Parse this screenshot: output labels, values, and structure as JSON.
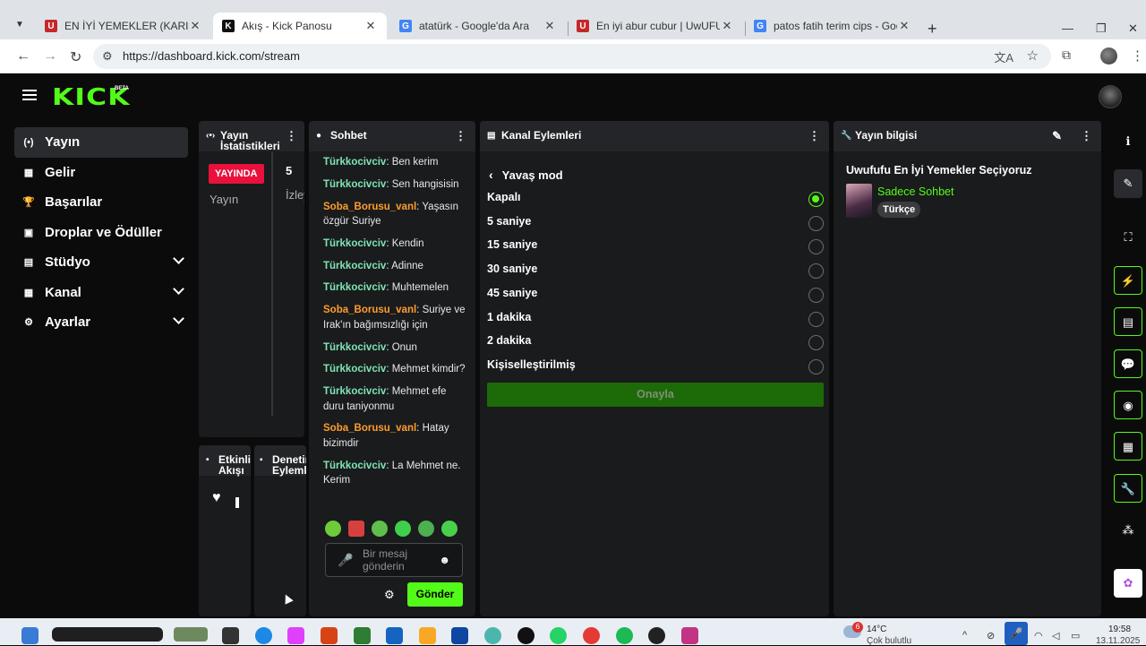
{
  "browser": {
    "tabs": [
      {
        "title": "EN İYİ YEMEKLER (KARIŞIK) @m",
        "fav_text": "U",
        "fav_color": "#c62828"
      },
      {
        "title": "Akış - Kick Panosu",
        "fav_text": "K",
        "fav_color": "#111111"
      },
      {
        "title": "atatürk - Google'da Ara",
        "fav_text": "G",
        "fav_color": "#4285f4"
      },
      {
        "title": "En iyi abur cubur | UwUFUFU",
        "fav_text": "U",
        "fav_color": "#c62828"
      },
      {
        "title": "patos fatih terim cips - Google",
        "fav_text": "G",
        "fav_color": "#4285f4"
      }
    ],
    "url": "https://dashboard.kick.com/stream"
  },
  "app": {
    "logo": "KICK",
    "logo_badge": "BETA",
    "accent": "#53fc18"
  },
  "sidebar": {
    "items": [
      {
        "label": "Yayın",
        "icon": "live-signal-icon",
        "glyph": "(•)",
        "active": true,
        "expand": false
      },
      {
        "label": "Gelir",
        "icon": "revenue-icon",
        "glyph": "▦",
        "expand": false
      },
      {
        "label": "Başarılar",
        "icon": "trophy-icon",
        "glyph": "🏆",
        "expand": false
      },
      {
        "label": "Droplar ve Ödüller",
        "icon": "gift-icon",
        "glyph": "▣",
        "expand": false
      },
      {
        "label": "Stüdyo",
        "icon": "studio-icon",
        "glyph": "▤",
        "expand": true
      },
      {
        "label": "Kanal",
        "icon": "channel-icon",
        "glyph": "▦",
        "expand": true
      },
      {
        "label": "Ayarlar",
        "icon": "settings-icon",
        "glyph": "⚙",
        "expand": true
      }
    ]
  },
  "stats": {
    "title": "Yayın İstatistikleri",
    "live_badge": "YAYINDA",
    "stream_label": "Yayın",
    "viewer_count": "5",
    "viewers_label": "İzley"
  },
  "activity": {
    "title": "Etkinlik Akışı"
  },
  "moderation": {
    "title": "Denetim Eylemleri"
  },
  "chat": {
    "title": "Sohbet",
    "messages": [
      {
        "user": "Türkkocivciv",
        "text": "Ben kerim",
        "color": "green"
      },
      {
        "user": "Türkkocivciv",
        "text": "Sen hangisisin",
        "color": "green"
      },
      {
        "user": "Soba_Borusu_vanl",
        "text": "Yaşasın özgür Suriye",
        "color": "orange"
      },
      {
        "user": "Türkkocivciv",
        "text": "Kendin",
        "color": "green"
      },
      {
        "user": "Türkkocivciv",
        "text": "Adinne",
        "color": "green"
      },
      {
        "user": "Türkkocivciv",
        "text": "Muhtemelen",
        "color": "green"
      },
      {
        "user": "Soba_Borusu_vanl",
        "text": "Suriye ve Irak'ın bağımsızlığı için",
        "color": "orange"
      },
      {
        "user": "Türkkocivciv",
        "text": "Onun",
        "color": "green"
      },
      {
        "user": "Türkkocivciv",
        "text": "Mehmet kimdir?",
        "color": "green"
      },
      {
        "user": "Türkkocivciv",
        "text": "Mehmet efe duru taniyonmu",
        "color": "green"
      },
      {
        "user": "Soba_Borusu_vanl",
        "text": "Hatay bizimdir",
        "color": "orange"
      },
      {
        "user": "Türkkocivciv",
        "text": "La Mehmet ne. Kerim",
        "color": "green"
      }
    ],
    "input_placeholder": "Bir mesaj gönderin",
    "send_label": "Gönder"
  },
  "channel_actions": {
    "title": "Kanal Eylemleri",
    "back_label": "Yavaş mod",
    "options": [
      {
        "label": "Kapalı",
        "selected": true
      },
      {
        "label": "5 saniye",
        "selected": false
      },
      {
        "label": "15 saniye",
        "selected": false
      },
      {
        "label": "30 saniye",
        "selected": false
      },
      {
        "label": "45 saniye",
        "selected": false
      },
      {
        "label": "1 dakika",
        "selected": false
      },
      {
        "label": "2 dakika",
        "selected": false
      },
      {
        "label": "Kişiselleştirilmiş",
        "selected": false
      }
    ],
    "confirm_label": "Onayla"
  },
  "stream_info": {
    "title": "Yayın bilgisi",
    "stream_title": "Uwufufu En İyi Yemekler Seçiyoruz",
    "category": "Sadece Sohbet",
    "language_tag": "Türkçe"
  },
  "taskbar": {
    "weather_badge": "6",
    "temperature": "14°C",
    "condition": "Çok bulutlu",
    "time": "19:58",
    "date": "13.11.2025"
  }
}
